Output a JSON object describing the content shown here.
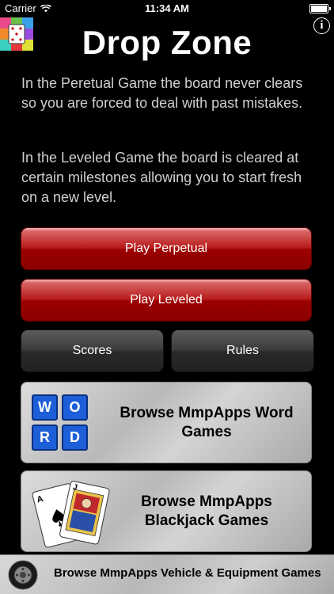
{
  "status_bar": {
    "carrier": "Carrier",
    "time": "11:34 AM"
  },
  "header": {
    "title": "Drop Zone"
  },
  "descriptions": {
    "perpetual": "In the Peretual Game the board never clears so you are forced to deal with past mistakes.",
    "leveled": "In the Leveled Game the board is cleared at certain milestones allowing you to start fresh on a new level."
  },
  "buttons": {
    "play_perpetual": "Play Perpetual",
    "play_leveled": "Play Leveled",
    "scores": "Scores",
    "rules": "Rules"
  },
  "promos": {
    "word": {
      "label": "Browse MmpApps Word Games",
      "tiles": [
        "W",
        "O",
        "R",
        "D"
      ]
    },
    "blackjack": {
      "label": "Browse MmpApps Blackjack Games",
      "card_ranks": [
        "A",
        "J"
      ]
    },
    "vehicle": {
      "label": "Browse MmpApps Vehicle & Equipment Games"
    }
  },
  "colors": {
    "play_button": "#b81a1a",
    "dark_button": "#3a3a3a",
    "tile": "#1d5fd8"
  },
  "icons": {
    "info": "i"
  }
}
